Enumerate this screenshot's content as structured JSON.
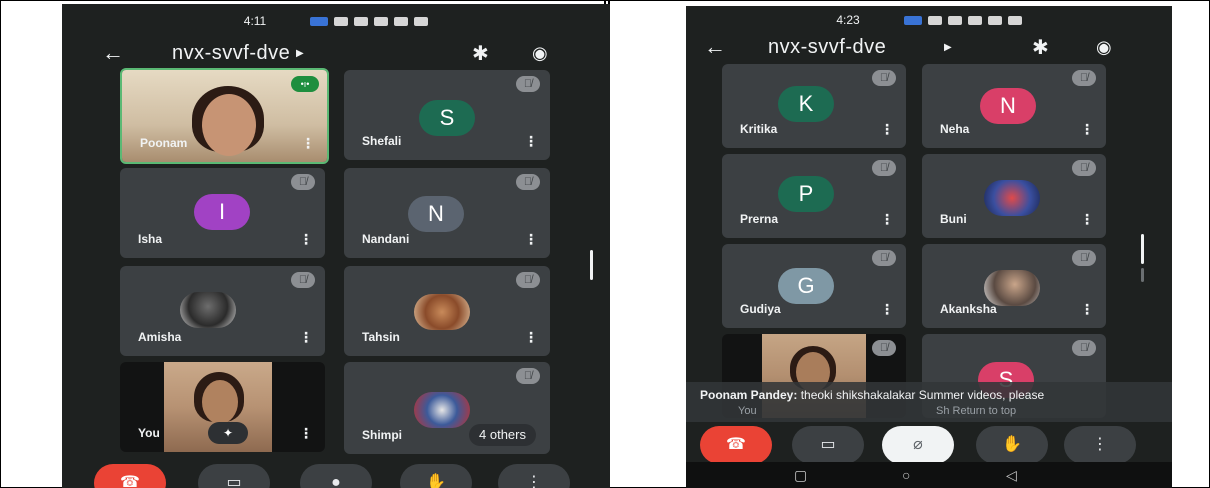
{
  "left_phone": {
    "status_time": "4:11",
    "meeting_title": "nvx-svvf-dve",
    "tiles": [
      {
        "name": "Poonam",
        "kind": "video",
        "speaking": true
      },
      {
        "name": "Shefali",
        "kind": "letter",
        "letter": "S",
        "avatar_color": "#1d6b52"
      },
      {
        "name": "Isha",
        "kind": "letter",
        "letter": "I",
        "avatar_color": "#a142c4"
      },
      {
        "name": "Nandani",
        "kind": "letter",
        "letter": "N",
        "avatar_color": "#5b6470"
      },
      {
        "name": "Amisha",
        "kind": "photo"
      },
      {
        "name": "Tahsin",
        "kind": "photo"
      },
      {
        "name": "You",
        "kind": "video"
      },
      {
        "name": "Shimpi",
        "kind": "photo",
        "others_label": "4 others"
      }
    ],
    "controls": [
      "end-call",
      "camera",
      "microphone",
      "raise-hand",
      "more"
    ]
  },
  "right_phone": {
    "status_time": "4:23",
    "meeting_title": "nvx-svvf-dve",
    "tiles": [
      {
        "name": "Kritika",
        "kind": "letter",
        "letter": "K",
        "avatar_color": "#1d6b52"
      },
      {
        "name": "Neha",
        "kind": "letter",
        "letter": "N",
        "avatar_color": "#d93f68"
      },
      {
        "name": "Prerna",
        "kind": "letter",
        "letter": "P",
        "avatar_color": "#1d6b52"
      },
      {
        "name": "Buni",
        "kind": "photo"
      },
      {
        "name": "Gudiya",
        "kind": "letter",
        "letter": "G",
        "avatar_color": "#7f98a5"
      },
      {
        "name": "Akanksha",
        "kind": "photo"
      },
      {
        "name": "You",
        "kind": "video"
      },
      {
        "name": "Sh",
        "kind": "letter",
        "letter": "S",
        "avatar_color": "#d93f68"
      }
    ],
    "caption": {
      "speaker": "Poonam Pandey:",
      "text": "theoki shikshakalakar Summer videos, please",
      "faint_left": "You",
      "faint_right": "Sh  Return to top"
    },
    "controls": [
      "end-call",
      "camera",
      "microphone-muted",
      "raise-hand",
      "more"
    ]
  }
}
